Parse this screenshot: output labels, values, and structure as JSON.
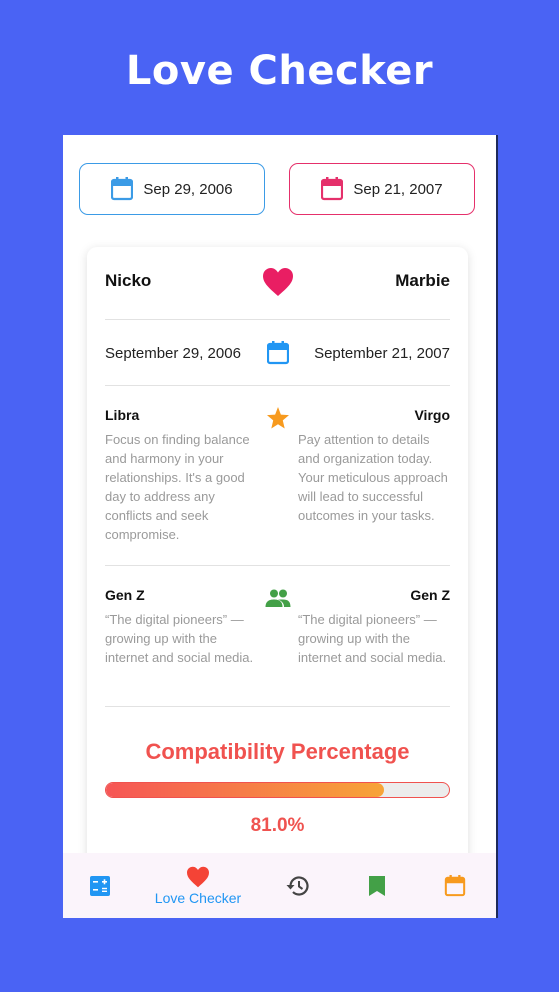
{
  "promo": {
    "title": "Love Checker"
  },
  "date_pickers": {
    "left": {
      "label": "Sep 29, 2006",
      "color": "#3b9be6"
    },
    "right": {
      "label": "Sep 21, 2007",
      "color": "#e5306b"
    }
  },
  "card": {
    "person_left": {
      "name": "Nicko",
      "full_date": "September 29, 2006"
    },
    "person_right": {
      "name": "Marbie",
      "full_date": "September 21, 2007"
    },
    "zodiac_left": {
      "sign": "Libra",
      "description": "Focus on finding balance and harmony in your relationships. It's a good day to address any conflicts and seek compromise."
    },
    "zodiac_right": {
      "sign": "Virgo",
      "description": "Pay attention to details and organization today. Your meticulous approach will lead to successful outcomes in your tasks."
    },
    "generation_left": {
      "name": "Gen Z",
      "description": "“The digital pioneers” — growing up with the internet and social media."
    },
    "generation_right": {
      "name": "Gen Z",
      "description": "“The digital pioneers” — growing up with the internet and social media."
    },
    "compatibility": {
      "title": "Compatibility Percentage",
      "value": 0.81,
      "label": "81.0%"
    },
    "icons": {
      "heart": "heart-icon",
      "calendar": "calendar-icon",
      "star": "star-icon",
      "people": "people-icon"
    }
  },
  "bottom_nav": {
    "items": [
      {
        "icon": "calculator-icon",
        "label": ""
      },
      {
        "icon": "heart-icon",
        "label": "Love Checker"
      },
      {
        "icon": "history-icon",
        "label": ""
      },
      {
        "icon": "bookmark-icon",
        "label": ""
      },
      {
        "icon": "calendar-icon",
        "label": ""
      }
    ]
  },
  "colors": {
    "background": "#4a63f4",
    "accent_pink": "#e91e63",
    "accent_blue": "#2196f3",
    "star_orange": "#f79a1e",
    "people_green": "#43a047",
    "compat_red": "#f0524f"
  }
}
